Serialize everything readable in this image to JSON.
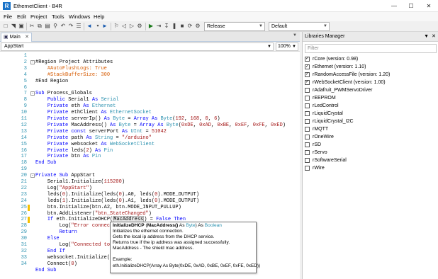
{
  "window": {
    "title": "EthernetClient - B4R",
    "app_icon_letter": "R",
    "minimize": "—",
    "maximize": "☐",
    "close": "✕"
  },
  "menu": [
    "File",
    "Edit",
    "Project",
    "Tools",
    "Windows",
    "Help"
  ],
  "toolbar": {
    "build_config": "Release",
    "device_profile": "Default"
  },
  "editor_tab": {
    "label": "Main",
    "close": "✕"
  },
  "sub_selector": {
    "value": "AppStart",
    "zoom": "100%"
  },
  "code": {
    "line_numbers": [
      "1",
      "2",
      "3",
      "4",
      "5",
      "6",
      "7",
      "8",
      "9",
      "10",
      "11",
      "12",
      "13",
      "14",
      "15",
      "16",
      "17",
      "18",
      "19",
      "20",
      "21",
      "22",
      "23",
      "24",
      "25",
      "26",
      "27",
      "28",
      "29",
      "30",
      "31",
      "32",
      "33",
      "34"
    ]
  },
  "tooltip": {
    "sig_name": "InitializeDHCP",
    "sig_open": " (",
    "sig_param": "MacAddress()",
    "sig_as1": " As ",
    "sig_type": "Byte",
    "sig_close": ") As ",
    "sig_ret": "Boolean",
    "lines": [
      "Initializes the ethernet connection.",
      "Gets the local ip address from the DHCP service.",
      "Returns true if the ip address was assigned successfully.",
      "MacAddress - The shield mac address."
    ],
    "example_label": "Example:",
    "example_code": "eth.InitializeDHCP(Array As Byte(0xDE, 0xAD, 0xBE, 0xEF, 0xFE, 0xED))"
  },
  "libraries": {
    "title": "Libraries Manager",
    "filter_placeholder": "Filter",
    "items": [
      {
        "label": "rCore (version: 0.98)",
        "checked": true
      },
      {
        "label": "rEthernet (version: 1.10)",
        "checked": true
      },
      {
        "label": "rRandomAccessFile (version: 1.20)",
        "checked": true
      },
      {
        "label": "rWebSocketClient (version: 1.00)",
        "checked": true
      },
      {
        "label": "rAdafruit_PWMServoDriver",
        "checked": false
      },
      {
        "label": "rEEPROM",
        "checked": false
      },
      {
        "label": "rLedControl",
        "checked": false
      },
      {
        "label": "rLiquidCrystal",
        "checked": false
      },
      {
        "label": "rLiquidCrystal_I2C",
        "checked": false
      },
      {
        "label": "rMQTT",
        "checked": false
      },
      {
        "label": "rOneWire",
        "checked": false
      },
      {
        "label": "rSD",
        "checked": false
      },
      {
        "label": "rServo",
        "checked": false
      },
      {
        "label": "rSoftwareSerial",
        "checked": false
      },
      {
        "label": "rWire",
        "checked": false
      }
    ]
  }
}
